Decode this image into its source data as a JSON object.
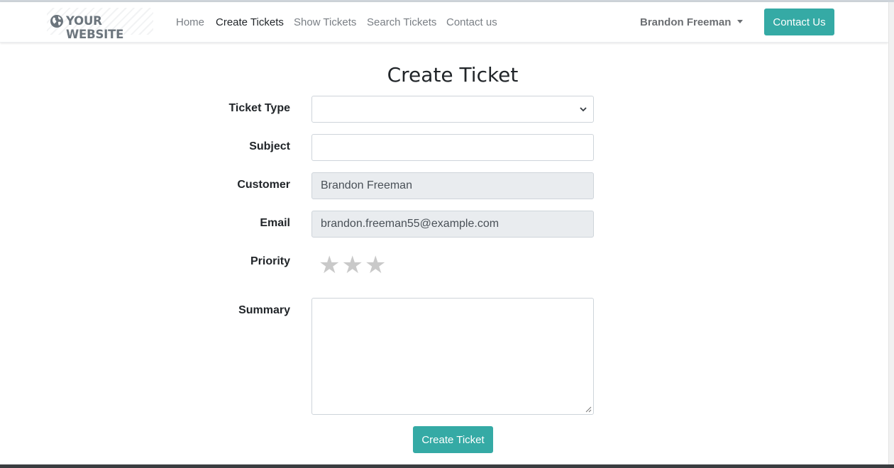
{
  "navbar": {
    "brand": "YOUR WEBSITE",
    "brand_icon": "globe-icon",
    "links": [
      "Home",
      "Create Tickets",
      "Show Tickets",
      "Search Tickets",
      "Contact us"
    ],
    "active_link": "Create Tickets",
    "user_name": "Brandon Freeman",
    "contact_button": "Contact Us"
  },
  "form": {
    "title": "Create Ticket",
    "ticket_type_label": "Ticket Type",
    "ticket_type_value": "",
    "subject_label": "Subject",
    "subject_value": "",
    "customer_label": "Customer",
    "customer_value": "Brandon Freeman",
    "email_label": "Email",
    "email_value": "brandon.freeman55@example.com",
    "priority_label": "Priority",
    "priority_stars": [
      "★",
      "★",
      "★"
    ],
    "priority_value": 0,
    "summary_label": "Summary",
    "summary_value": "",
    "submit_button": "Create Ticket"
  },
  "colors": {
    "accent": "#35aaa5",
    "star_inactive": "#c9c9c9",
    "readonly_bg": "#e9ecef"
  }
}
